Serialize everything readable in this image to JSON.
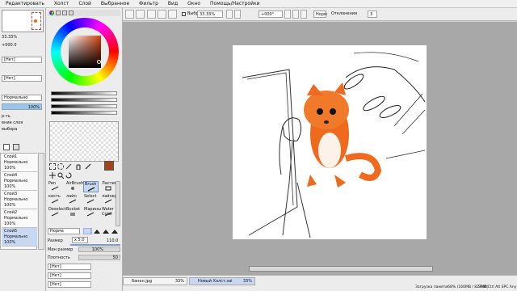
{
  "menu": [
    "Редактировать",
    "Холст",
    "Слой",
    "Выбранное",
    "Фильтр",
    "Вид",
    "Окно",
    "Помощь/Настройки"
  ],
  "toolbar": {
    "selected_label": "Выбранное",
    "zoom": "33.33%",
    "rotation": "+000°",
    "mode": "Норм",
    "stabilizer_label": "Отклонения",
    "stabilizer_value": "3"
  },
  "navigator": {
    "zoom": "33.33%",
    "rotation": "+000.0"
  },
  "layer_panel": {
    "dropdown1": "[Нет]",
    "dropdown2": "[Нет]",
    "blend_mode": "Нормально",
    "opacity": "100%",
    "label_fragment1": "р-ть",
    "label_fragment2": "ение слоя",
    "label_fragment3": "выбора",
    "layers": [
      {
        "name": "Слой1",
        "mode": "Нормально",
        "opacity": "100%"
      },
      {
        "name": "Слой4",
        "mode": "Нормально",
        "opacity": "100%"
      },
      {
        "name": "Слой3",
        "mode": "Нормально",
        "opacity": "100%"
      },
      {
        "name": "Слой2",
        "mode": "Нормально",
        "opacity": "100%"
      },
      {
        "name": "Слой5",
        "mode": "Нормально",
        "opacity": "100%"
      }
    ]
  },
  "tools": {
    "cells": [
      "Pen",
      "AirBrush",
      "Brush",
      "Ластик",
      "кисть",
      "лайн",
      "Select",
      "лайнерт",
      "Deselect",
      "Bucket",
      "Марины",
      "Water Color"
    ],
    "blend": "Норма",
    "size_label": "Размер",
    "size_multiplier": "x 5.0",
    "size_value": "110.0",
    "min_size_label": "Мин размер",
    "min_size_value": "100%",
    "density_label": "Плотность",
    "density_value": "50",
    "dropdowns": [
      "[Нет]",
      "[Нет]",
      "[Нет]"
    ]
  },
  "tabs": [
    {
      "name": "банан.jpg",
      "zoom": "33%"
    },
    {
      "name": "Новый Холст.sai",
      "zoom": "33%"
    }
  ],
  "status": {
    "memory": "Загрузка памяти68% (160MB / 827MB)",
    "keys": "Shift Ctrl Alt SPC Any"
  },
  "colors": {
    "accent_fg": "#a0441c",
    "fox_orange": "#f06a1e",
    "selection_blue": "#c9d8f2"
  }
}
